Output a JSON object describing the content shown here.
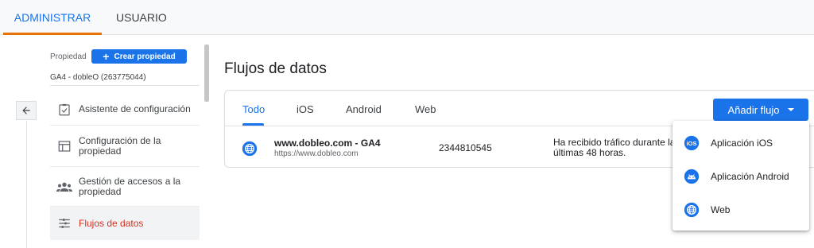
{
  "top_tabs": [
    {
      "label": "ADMINISTRAR",
      "active": true
    },
    {
      "label": "USUARIO",
      "active": false
    }
  ],
  "accent": "#1a73e8",
  "sidebar": {
    "property_label": "Propiedad",
    "create_property": "Crear propiedad",
    "property_id": "GA4 - dobleO (263775044)",
    "items": [
      {
        "label": "Asistente de configuración",
        "icon": "checklist-icon"
      },
      {
        "label": "Configuración de la propiedad",
        "icon": "property-settings-icon"
      },
      {
        "label": "Gestión de accesos a la propiedad",
        "icon": "people-icon"
      },
      {
        "label": "Flujos de datos",
        "icon": "data-streams-icon",
        "active": true
      }
    ]
  },
  "main": {
    "title": "Flujos de datos",
    "tabs": [
      "Todo",
      "iOS",
      "Android",
      "Web"
    ],
    "active_tab": "Todo",
    "add_stream": "Añadir flujo",
    "stream": {
      "name": "www.dobleo.com - GA4",
      "url": "https://www.dobleo.com",
      "id": "2344810545",
      "status": "Ha recibido tráfico durante las últimas 48 horas."
    }
  },
  "menu": {
    "items": [
      {
        "label": "Aplicación iOS",
        "icon": "ios-icon"
      },
      {
        "label": "Aplicación Android",
        "icon": "android-icon"
      },
      {
        "label": "Web",
        "icon": "web-icon"
      }
    ]
  }
}
